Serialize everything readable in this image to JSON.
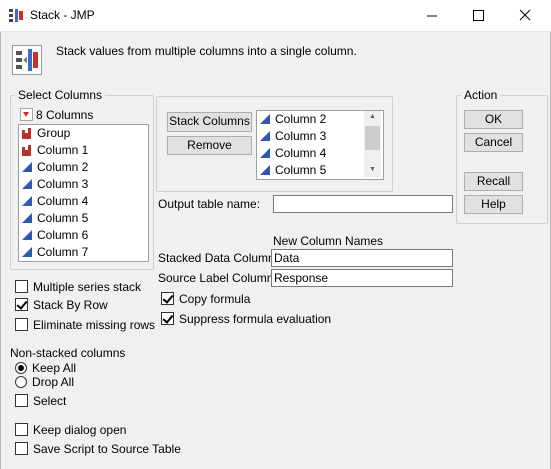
{
  "window": {
    "title": "Stack - JMP",
    "controls": [
      "minimize-icon",
      "maximize-icon",
      "close-icon"
    ]
  },
  "description": "Stack values from multiple columns into a single column.",
  "select_columns": {
    "title": "Select Columns",
    "count_label": "8 Columns",
    "items": [
      {
        "label": "Group",
        "icon": "nominal-bar-icon"
      },
      {
        "label": "Column 1",
        "icon": "nominal-bar-icon"
      },
      {
        "label": "Column 2",
        "icon": "continuous-triangle-icon"
      },
      {
        "label": "Column 3",
        "icon": "continuous-triangle-icon"
      },
      {
        "label": "Column 4",
        "icon": "continuous-triangle-icon"
      },
      {
        "label": "Column 5",
        "icon": "continuous-triangle-icon"
      },
      {
        "label": "Column 6",
        "icon": "continuous-triangle-icon"
      },
      {
        "label": "Column 7",
        "icon": "continuous-triangle-icon"
      }
    ]
  },
  "stack_panel": {
    "stack_button": "Stack Columns",
    "remove_button": "Remove",
    "stacked_items": [
      "Column 2",
      "Column 3",
      "Column 4",
      "Column 5"
    ]
  },
  "output_table": {
    "label": "Output table name:",
    "value": ""
  },
  "new_column_names": {
    "title": "New Column Names",
    "stacked_data_label": "Stacked Data Column",
    "stacked_data_value": "Data",
    "source_label_label": "Source Label Column",
    "source_label_value": "Response"
  },
  "options": {
    "copy_formula": {
      "label": "Copy formula",
      "checked": true
    },
    "suppress_formula": {
      "label": "Suppress formula evaluation",
      "checked": true
    },
    "multiple_series": {
      "label": "Multiple series stack",
      "checked": false
    },
    "stack_by_row": {
      "label": "Stack By Row",
      "checked": true
    },
    "eliminate_missing": {
      "label": "Eliminate missing rows",
      "checked": false
    }
  },
  "non_stacked": {
    "title": "Non-stacked columns",
    "keep_all": {
      "label": "Keep All",
      "selected": true
    },
    "drop_all": {
      "label": "Drop All",
      "selected": false
    },
    "select": {
      "label": "Select",
      "checked": false
    }
  },
  "footer": {
    "keep_dialog_open": {
      "label": "Keep dialog open",
      "checked": false
    },
    "save_script": {
      "label": "Save Script to Source Table",
      "checked": false
    }
  },
  "action": {
    "title": "Action",
    "ok": "OK",
    "cancel": "Cancel",
    "recall": "Recall",
    "help": "Help"
  },
  "colors": {
    "nominal_icon": "#b5312a",
    "continuous_icon": "#2f58b0",
    "dialog_background": "#f0f0f0"
  }
}
